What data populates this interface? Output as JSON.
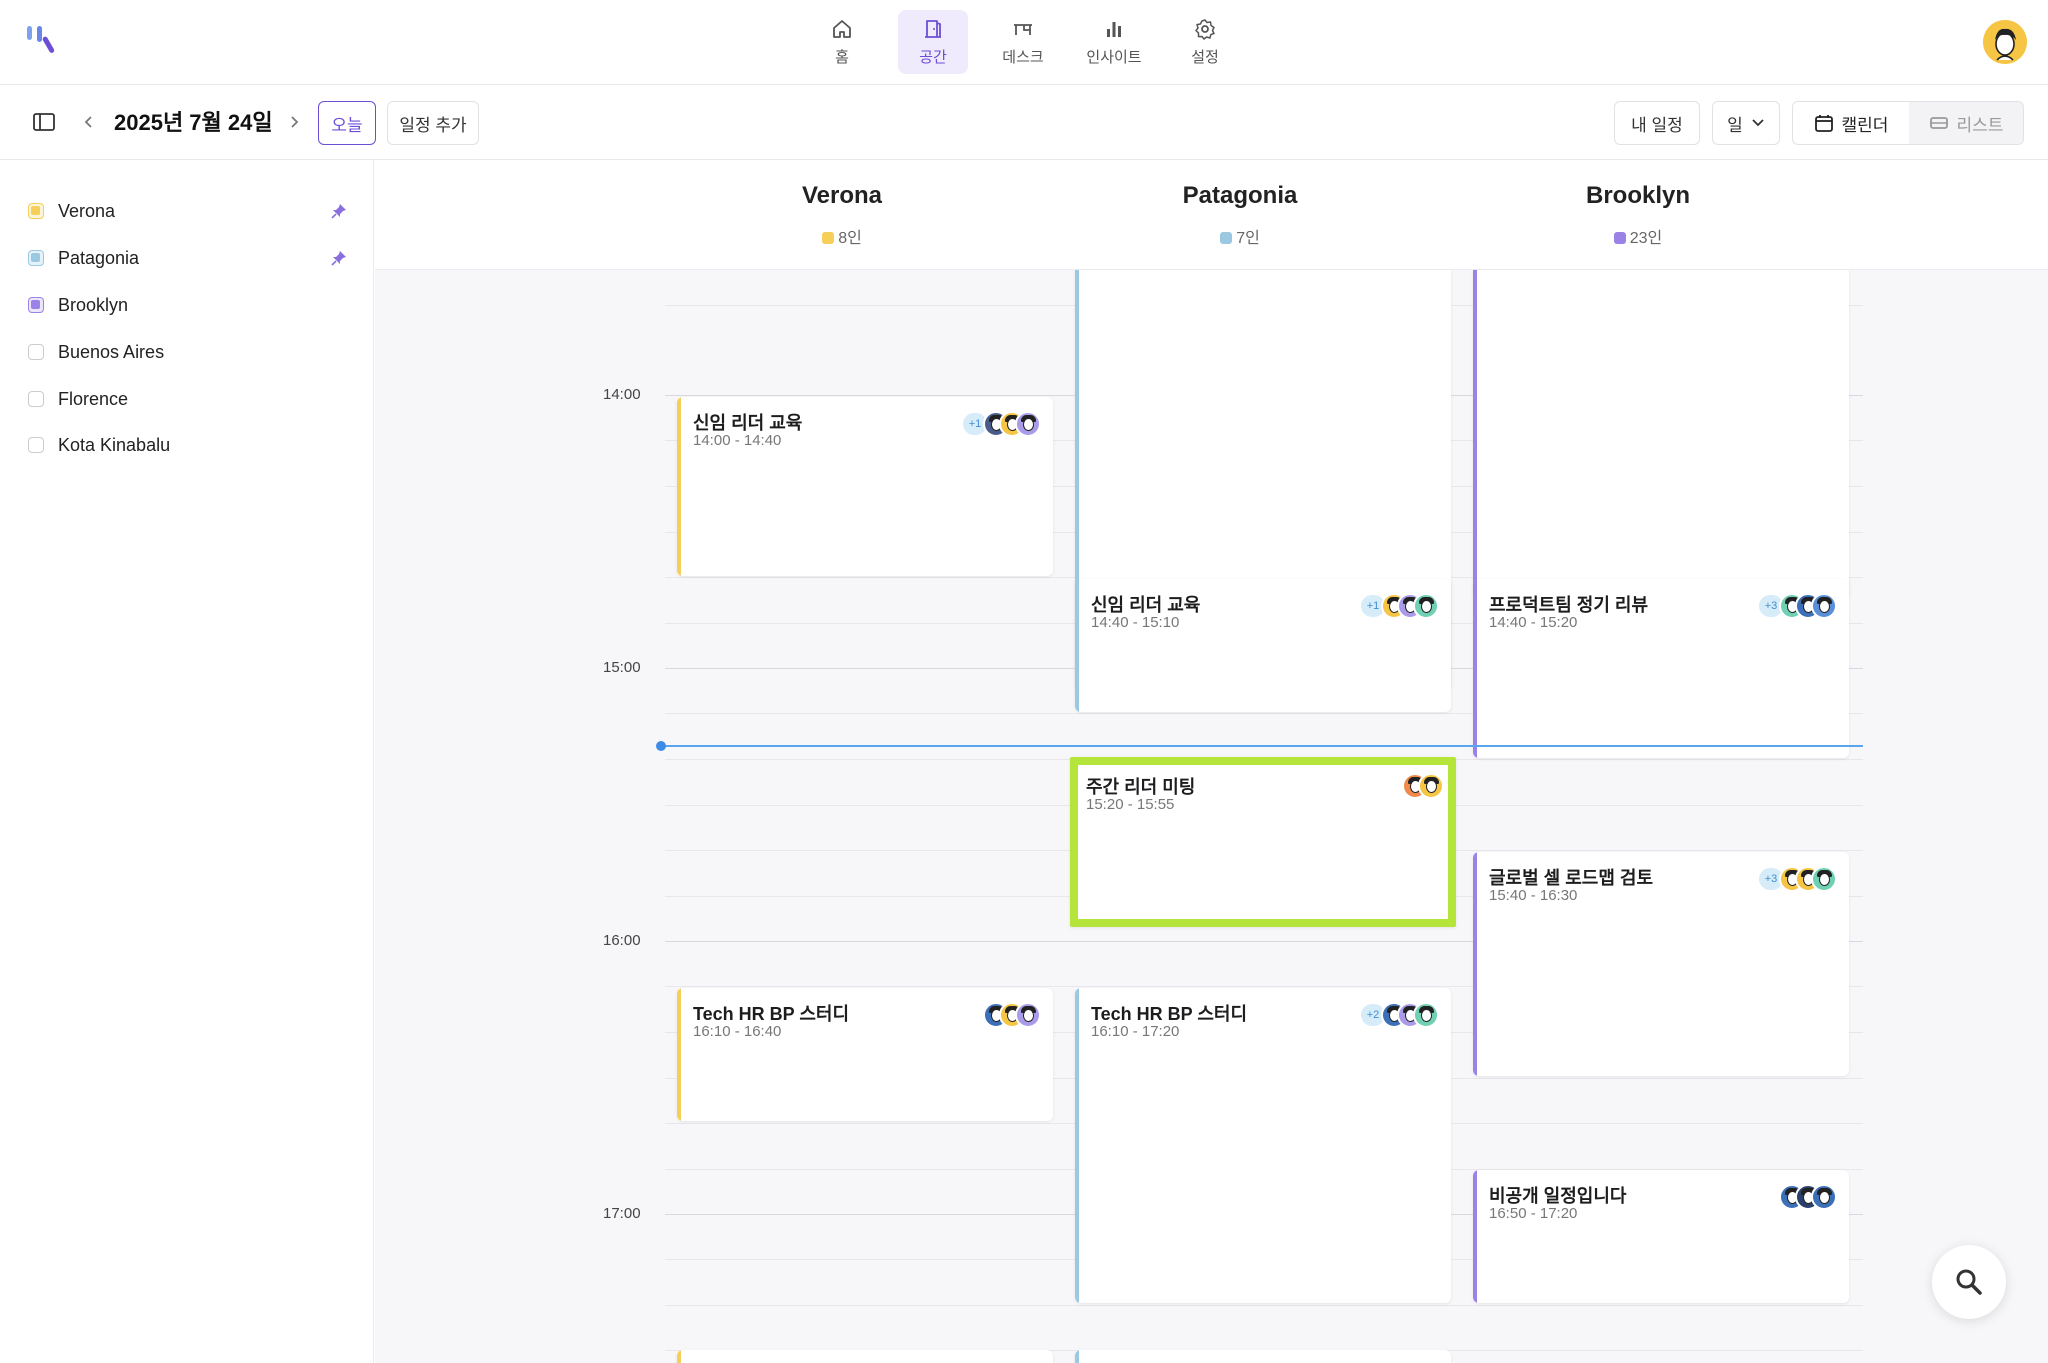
{
  "nav": {
    "items": [
      {
        "label": "홈",
        "icon": "home-icon"
      },
      {
        "label": "공간",
        "icon": "door-icon",
        "active": true
      },
      {
        "label": "데스크",
        "icon": "desk-icon"
      },
      {
        "label": "인사이트",
        "icon": "bar-chart-icon"
      },
      {
        "label": "설정",
        "icon": "gear-icon"
      }
    ]
  },
  "toolbar": {
    "date": "2025년 7월 24일",
    "today_label": "오늘",
    "add_event_label": "일정 추가",
    "my_schedule_label": "내 일정",
    "view_select_value": "일",
    "calendar_label": "캘린더",
    "list_label": "리스트"
  },
  "sidebar": {
    "rooms": [
      {
        "name": "Verona",
        "color": "#f5cf5a",
        "checked": true,
        "pinned": true
      },
      {
        "name": "Patagonia",
        "color": "#9cc9e2",
        "checked": true,
        "pinned": true
      },
      {
        "name": "Brooklyn",
        "color": "#9b82e6",
        "checked": true,
        "pinned": false
      },
      {
        "name": "Buenos Aires",
        "color": "",
        "checked": false,
        "pinned": false
      },
      {
        "name": "Florence",
        "color": "",
        "checked": false,
        "pinned": false
      },
      {
        "name": "Kota Kinabalu",
        "color": "",
        "checked": false,
        "pinned": false
      }
    ]
  },
  "columns": [
    {
      "name": "Verona",
      "count": "8인",
      "color": "#f5cf5a"
    },
    {
      "name": "Patagonia",
      "count": "7인",
      "color": "#9cc9e2"
    },
    {
      "name": "Brooklyn",
      "count": "23인",
      "color": "#9b82e6"
    }
  ],
  "hours": [
    "14:00",
    "15:00",
    "16:00",
    "17:00"
  ],
  "events": {
    "verona_1": {
      "title": "신임 리더 교육",
      "time": "14:00 - 14:40",
      "extra": "+1"
    },
    "verona_2": {
      "title": "Tech HR BP 스터디",
      "time": "16:10 - 16:40",
      "extra": ""
    },
    "patagonia_1": {
      "title": "신임 리더 교육",
      "time": "14:40 - 15:10",
      "extra": "+1"
    },
    "patagonia_2": {
      "title": "주간 리더 미팅",
      "time": "15:20 - 15:55",
      "extra": ""
    },
    "patagonia_3": {
      "title": "Tech HR BP 스터디",
      "time": "16:10 - 17:20",
      "extra": "+2"
    },
    "brooklyn_1": {
      "title": "프로덕트팀 정기 리뷰",
      "time": "14:40 - 15:20",
      "extra": "+3"
    },
    "brooklyn_2": {
      "title": "글로벌 셀 로드맵 검토",
      "time": "15:40 - 16:30",
      "extra": "+3"
    },
    "brooklyn_3": {
      "title": "비공개 일정입니다",
      "time": "16:50 - 17:20",
      "extra": ""
    }
  },
  "colors": {
    "accent": "#6c4fd6",
    "highlight": "#b5e53a",
    "now_line": "#5aa6ee"
  }
}
